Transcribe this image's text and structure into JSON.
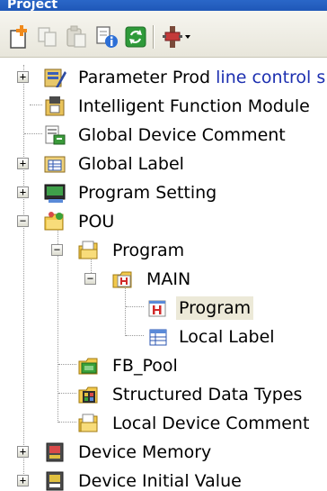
{
  "panel": {
    "title": "Project"
  },
  "toolbar": {
    "buttons": [
      {
        "icon": "new-item-icon"
      },
      {
        "icon": "copy-icon"
      },
      {
        "icon": "paste-icon"
      },
      {
        "icon": "properties-icon"
      },
      {
        "icon": "refresh-icon"
      },
      {
        "icon": "connection-dropdown-icon"
      }
    ]
  },
  "tree": {
    "items": [
      {
        "label_plain": "Parameter Prod ",
        "label_blue": "line control s",
        "icon": "parameter-icon",
        "expander": "+"
      },
      {
        "label": "Intelligent Function Module",
        "icon": "intelligent-module-icon"
      },
      {
        "label": "Global Device Comment",
        "icon": "device-comment-icon"
      },
      {
        "label": "Global Label",
        "icon": "global-label-icon",
        "expander": "+"
      },
      {
        "label": "Program Setting",
        "icon": "program-setting-icon",
        "expander": "+"
      },
      {
        "label": "POU",
        "icon": "pou-folder-icon",
        "expander": "−"
      },
      {
        "label": "Program",
        "icon": "program-folder-icon",
        "expander": "−"
      },
      {
        "label": "MAIN",
        "icon": "main-program-icon",
        "expander": "−"
      },
      {
        "label": "Program",
        "icon": "ladder-program-icon",
        "selected": true
      },
      {
        "label": "Local Label",
        "icon": "local-label-icon"
      },
      {
        "label": "FB_Pool",
        "icon": "fb-pool-icon"
      },
      {
        "label": "Structured Data Types",
        "icon": "structured-data-icon"
      },
      {
        "label": "Local Device Comment",
        "icon": "local-device-comment-icon"
      },
      {
        "label": "Device Memory",
        "icon": "device-memory-icon",
        "expander": "+"
      },
      {
        "label": "Device Initial Value",
        "icon": "device-initial-value-icon",
        "expander": "+"
      }
    ]
  }
}
